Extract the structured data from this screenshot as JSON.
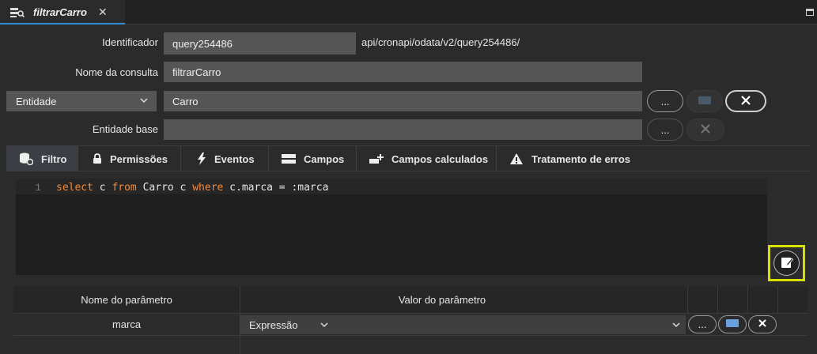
{
  "tab": {
    "title": "filtrarCarro",
    "close": "✕",
    "icon": "query-icon"
  },
  "form": {
    "identificador_label": "Identificador",
    "identificador_value": "query254486",
    "endpoint": "api/cronapi/odata/v2/query254486/",
    "nome_label": "Nome da consulta",
    "nome_value": "filtrarCarro",
    "entidade_select": "Entidade",
    "entidade_value": "Carro",
    "entidade_base_label": "Entidade base",
    "entidade_base_value": "",
    "ellipsis": "..."
  },
  "subtabs": [
    {
      "label": "Filtro",
      "icon": "database-icon"
    },
    {
      "label": "Permissões",
      "icon": "lock-icon"
    },
    {
      "label": "Eventos",
      "icon": "lightning-icon"
    },
    {
      "label": "Campos",
      "icon": "columns-icon"
    },
    {
      "label": "Campos calculados",
      "icon": "add-field-icon"
    },
    {
      "label": "Tratamento de erros",
      "icon": "warning-icon"
    }
  ],
  "editor": {
    "line_number": "1",
    "tokens": {
      "t1": "select",
      "t2": " c ",
      "t3": "from",
      "t4": " Carro c ",
      "t5": "where",
      "t6": " c.marca = :marca"
    }
  },
  "params": {
    "header_name": "Nome do parâmetro",
    "header_value": "Valor do parâmetro",
    "row_name": "marca",
    "row_value": "Expressão",
    "ellipsis": "..."
  },
  "colors": {
    "accent": "#2f8fd8",
    "keyword": "#f28a3d",
    "highlight": "#d8e000"
  }
}
